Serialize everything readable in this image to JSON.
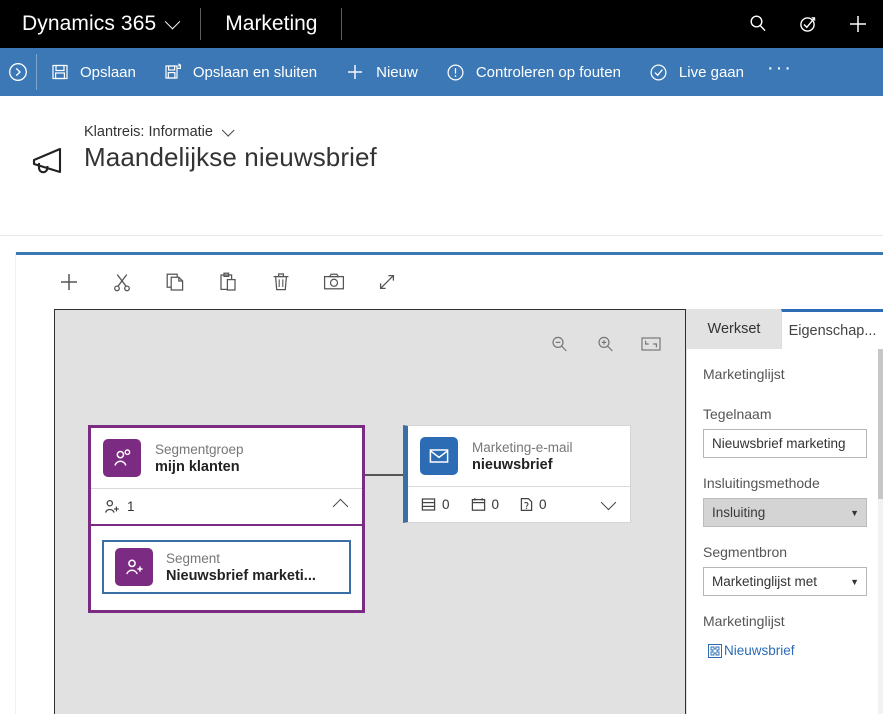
{
  "topnav": {
    "brand": "Dynamics 365",
    "brand_chevron_icon": "chevron-down-icon",
    "app_name": "Marketing",
    "actions": [
      {
        "icon": "search-icon",
        "name": "search-button"
      },
      {
        "icon": "assistant-icon",
        "name": "assistant-button"
      },
      {
        "icon": "plus-icon",
        "name": "quick-create-button"
      }
    ]
  },
  "commandbar": {
    "back_icon": "circle-chevron-right-icon",
    "items": [
      {
        "label": "Opslaan",
        "icon": "save-icon",
        "name": "save-command"
      },
      {
        "label": "Opslaan en sluiten",
        "icon": "save-close-icon",
        "name": "save-and-close-command"
      },
      {
        "label": "Nieuw",
        "icon": "plus-icon",
        "name": "new-command"
      },
      {
        "label": "Controleren op fouten",
        "icon": "error-check-icon",
        "name": "check-errors-command"
      },
      {
        "label": "Live gaan",
        "icon": "check-circle-icon",
        "name": "go-live-command"
      }
    ],
    "overflow_label": "···"
  },
  "record_header": {
    "entity_icon": "megaphone-icon",
    "breadcrumb": "Klantreis: Informatie",
    "breadcrumb_chevron_icon": "chevron-down-icon",
    "title": "Maandelijkse nieuwsbrief"
  },
  "designer_toolbar": [
    {
      "icon": "plus-icon",
      "name": "add-tile-button"
    },
    {
      "icon": "scissors-icon",
      "name": "cut-button"
    },
    {
      "icon": "copy-icon",
      "name": "copy-button"
    },
    {
      "icon": "paste-icon",
      "name": "paste-button"
    },
    {
      "icon": "trash-icon",
      "name": "delete-button"
    },
    {
      "icon": "camera-icon",
      "name": "snapshot-button"
    },
    {
      "icon": "expand-arrows-icon",
      "name": "expand-button"
    }
  ],
  "canvas_controls": [
    {
      "icon": "zoom-out-icon",
      "name": "zoom-out-button"
    },
    {
      "icon": "zoom-in-icon",
      "name": "zoom-in-button"
    },
    {
      "icon": "fit-to-screen-icon",
      "name": "fit-to-screen-button"
    }
  ],
  "canvas": {
    "segment_group": {
      "type": "Segmentgroep",
      "name": "mijn klanten",
      "icon": "segment-group-icon",
      "count": "1",
      "count_icon": "add-person-icon",
      "collapse_icon": "chevron-up-icon",
      "children": [
        {
          "type": "Segment",
          "name": "Nieuwsbrief marketi...",
          "icon": "add-person-icon",
          "selected": true
        }
      ]
    },
    "email_tile": {
      "type": "Marketing-e-mail",
      "name": "nieuwsbrief",
      "icon": "envelope-icon",
      "expand_icon": "chevron-down-icon",
      "stats": [
        {
          "icon": "layout-icon",
          "value": "0"
        },
        {
          "icon": "calendar-icon",
          "value": "0"
        },
        {
          "icon": "question-doc-icon",
          "value": "0"
        }
      ]
    }
  },
  "panel": {
    "tabs": [
      {
        "label": "Werkset",
        "active": false,
        "name": "tab-toolbox"
      },
      {
        "label": "Eigenschap...",
        "active": true,
        "name": "tab-properties"
      }
    ],
    "section_title": "Marketinglijst",
    "fields": [
      {
        "label": "Tegelnaam",
        "kind": "text",
        "value": "Nieuwsbrief marketing",
        "name": "tile-name-input"
      },
      {
        "label": "Insluitingsmethode",
        "kind": "select",
        "value": "Insluiting",
        "disabled": true,
        "caret_icon": "caret-down-icon",
        "name": "inclusion-method-select"
      },
      {
        "label": "Segmentbron",
        "kind": "select",
        "value": "Marketinglijst met",
        "disabled": false,
        "caret_icon": "caret-down-icon",
        "name": "segment-source-select"
      },
      {
        "label": "Marketinglijst",
        "kind": "lookup",
        "value": "Nieuwsbrief",
        "icon": "broken-image-icon",
        "name": "marketing-list-lookup"
      }
    ]
  },
  "colors": {
    "topnav_bg": "#000000",
    "command_bar": "#3b78b5",
    "accent_blue": "#2b6cb5",
    "segment_purple": "#7b2c82",
    "canvas_bg": "#e1e1e1"
  }
}
